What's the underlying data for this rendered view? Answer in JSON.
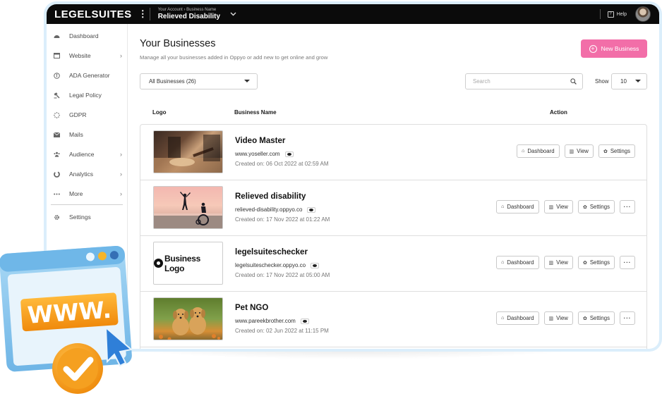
{
  "topbar": {
    "brand": "LEGELSUITES",
    "kebab": "⋮",
    "account_crumb": "Your Account › Business Name",
    "account_name": "Relieved Disability",
    "help_label": "Help"
  },
  "sidebar": {
    "items": [
      {
        "label": "Dashboard",
        "icon": "dashboard-icon",
        "chevron": false
      },
      {
        "label": "Website",
        "icon": "website-icon",
        "chevron": true
      },
      {
        "label": "ADA Generator",
        "icon": "ada-icon",
        "chevron": false
      },
      {
        "label": "Legal Policy",
        "icon": "gavel-icon",
        "chevron": false
      },
      {
        "label": "GDPR",
        "icon": "gdpr-icon",
        "chevron": false
      },
      {
        "label": "Mails",
        "icon": "mail-icon",
        "chevron": false
      },
      {
        "label": "Audience",
        "icon": "audience-icon",
        "chevron": true
      },
      {
        "label": "Analytics",
        "icon": "analytics-icon",
        "chevron": true
      },
      {
        "label": "More",
        "icon": "more-icon",
        "chevron": true
      },
      {
        "label": "Settings",
        "icon": "settings-icon",
        "chevron": false
      }
    ]
  },
  "main": {
    "title": "Your Businesses",
    "subtitle": "Manage all your businesses added in Oppyo or add new to get online and grow",
    "new_button": "New Business",
    "filter_value": "All Businesses (26)",
    "search_placeholder": "Search",
    "show_label": "Show",
    "show_value": "10",
    "columns": {
      "logo": "Logo",
      "name": "Business Name",
      "action": "Action"
    },
    "action_labels": {
      "dashboard": "Dashboard",
      "view": "View",
      "settings": "Settings",
      "more": "···"
    },
    "businesses": [
      {
        "name": "Video Master",
        "url": "www.yoseller.com",
        "created": "Created on: 06 Oct 2022 at 02:59 AM",
        "thumb": "video-master-thumbnail",
        "has_more": false
      },
      {
        "name": "Relieved disability",
        "url": "relieved-disability.oppyo.co",
        "created": "Created on: 17 Nov 2022 at 01:22 AM",
        "thumb": "relieved-disability-thumbnail",
        "has_more": true
      },
      {
        "name": "legelsuiteschecker",
        "url": "legelsuiteschecker.oppyo.co",
        "created": "Created on: 17 Nov 2022 at 05:00 AM",
        "thumb": "business-logo-thumbnail",
        "logo_text": "Business Logo",
        "has_more": true
      },
      {
        "name": "Pet NGO",
        "url": "www.pareekbrother.com",
        "created": "Created on: 02 Jun 2022 at 11:15 PM",
        "thumb": "pet-ngo-thumbnail",
        "has_more": true
      }
    ]
  },
  "illustration": {
    "text": "WWW.",
    "colors": {
      "window": "#8cc9ef",
      "banner": "#f7a21b",
      "check": "#f39a12",
      "cursor": "#2f7fd8"
    }
  },
  "colors": {
    "accent": "#f26ea8",
    "topbar": "#0b0b0b",
    "frame": "#dbeefb"
  }
}
